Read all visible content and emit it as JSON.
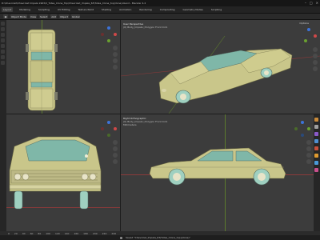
{
  "window": {
    "title": "D:\\Chevrolet\\Chevrolet Impala 1963\\2_Tutes_Clone_Top\\Chevrolet_Impala_63\\Tutes_Clone_top(done).blend - Blender 4.2"
  },
  "menubar": {
    "items": [
      "Layout",
      "Modeling",
      "Sculpting",
      "UV Editing",
      "Texture Paint",
      "Shading",
      "Animation",
      "Rendering",
      "Compositing",
      "Geometry Nodes",
      "Scripting",
      "Layout"
    ]
  },
  "toolbar": {
    "mode_label": "Object Mode",
    "view_label": "View",
    "select_label": "Select",
    "add_label": "Add",
    "object_label": "Object",
    "orientation_label": "Global"
  },
  "viewports": {
    "top_left": {
      "label": "",
      "sub": ""
    },
    "top_right": {
      "label": "User Perspective",
      "sub": "(0) Body_Impala | Polygon Front 0.01"
    },
    "bottom_left": {
      "label": "",
      "sub": ""
    },
    "bottom_right": {
      "label": "Right Orthographic",
      "sub": "(0) Body_Impala | Polygon Front 0.01",
      "sub2": "Millimeters"
    }
  },
  "options_label": "Options",
  "timeline": {
    "marks": [
      "0",
      "10",
      "20",
      "30",
      "40",
      "50",
      "60",
      "70",
      "80",
      "90",
      "100",
      "110",
      "120",
      "130",
      "140",
      "150",
      "160",
      "170",
      "180",
      "190",
      "200",
      "210",
      "220",
      "230",
      "240",
      "250"
    ]
  },
  "status": {
    "text": "Saved \"Chevrolet_Impala_63(Tutes_Clone_top)(done)\""
  },
  "colors": {
    "car_body": "#c9c68a",
    "car_glass": "#7fb7a8",
    "tire": "#9fd0c0",
    "axis_x": "#d04848",
    "axis_y": "#6aa030",
    "axis_z": "#3c72d8"
  }
}
